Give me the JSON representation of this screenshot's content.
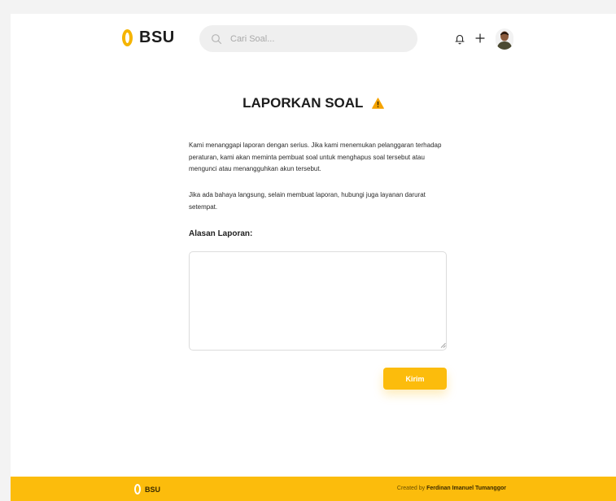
{
  "header": {
    "brand": "BSU",
    "search_placeholder": "Cari Soal...",
    "icons": [
      "logo-icon",
      "search-icon",
      "bell-icon",
      "plus-icon",
      "avatar"
    ]
  },
  "main": {
    "title": "LAPORKAN SOAL",
    "paragraph1": "Kami menanggapi laporan dengan serius. Jika kami menemukan pelanggaran terhadap peraturan, kami akan meminta pembuat soal untuk menghapus soal tersebut atau mengunci atau menangguhkan akun tersebut.",
    "paragraph2": "Jika ada bahaya langsung, selain membuat laporan, hubungi juga layanan darurat setempat.",
    "reason_label": "Alasan Laporan:",
    "reason_value": "",
    "submit_label": "Kirim"
  },
  "footer": {
    "brand": "BSU",
    "credit_prefix": "Created by",
    "credit_name": "Ferdinan Imanuel Tumanggor"
  },
  "colors": {
    "accent": "#fcbc0c",
    "warning": "#f5a300"
  }
}
